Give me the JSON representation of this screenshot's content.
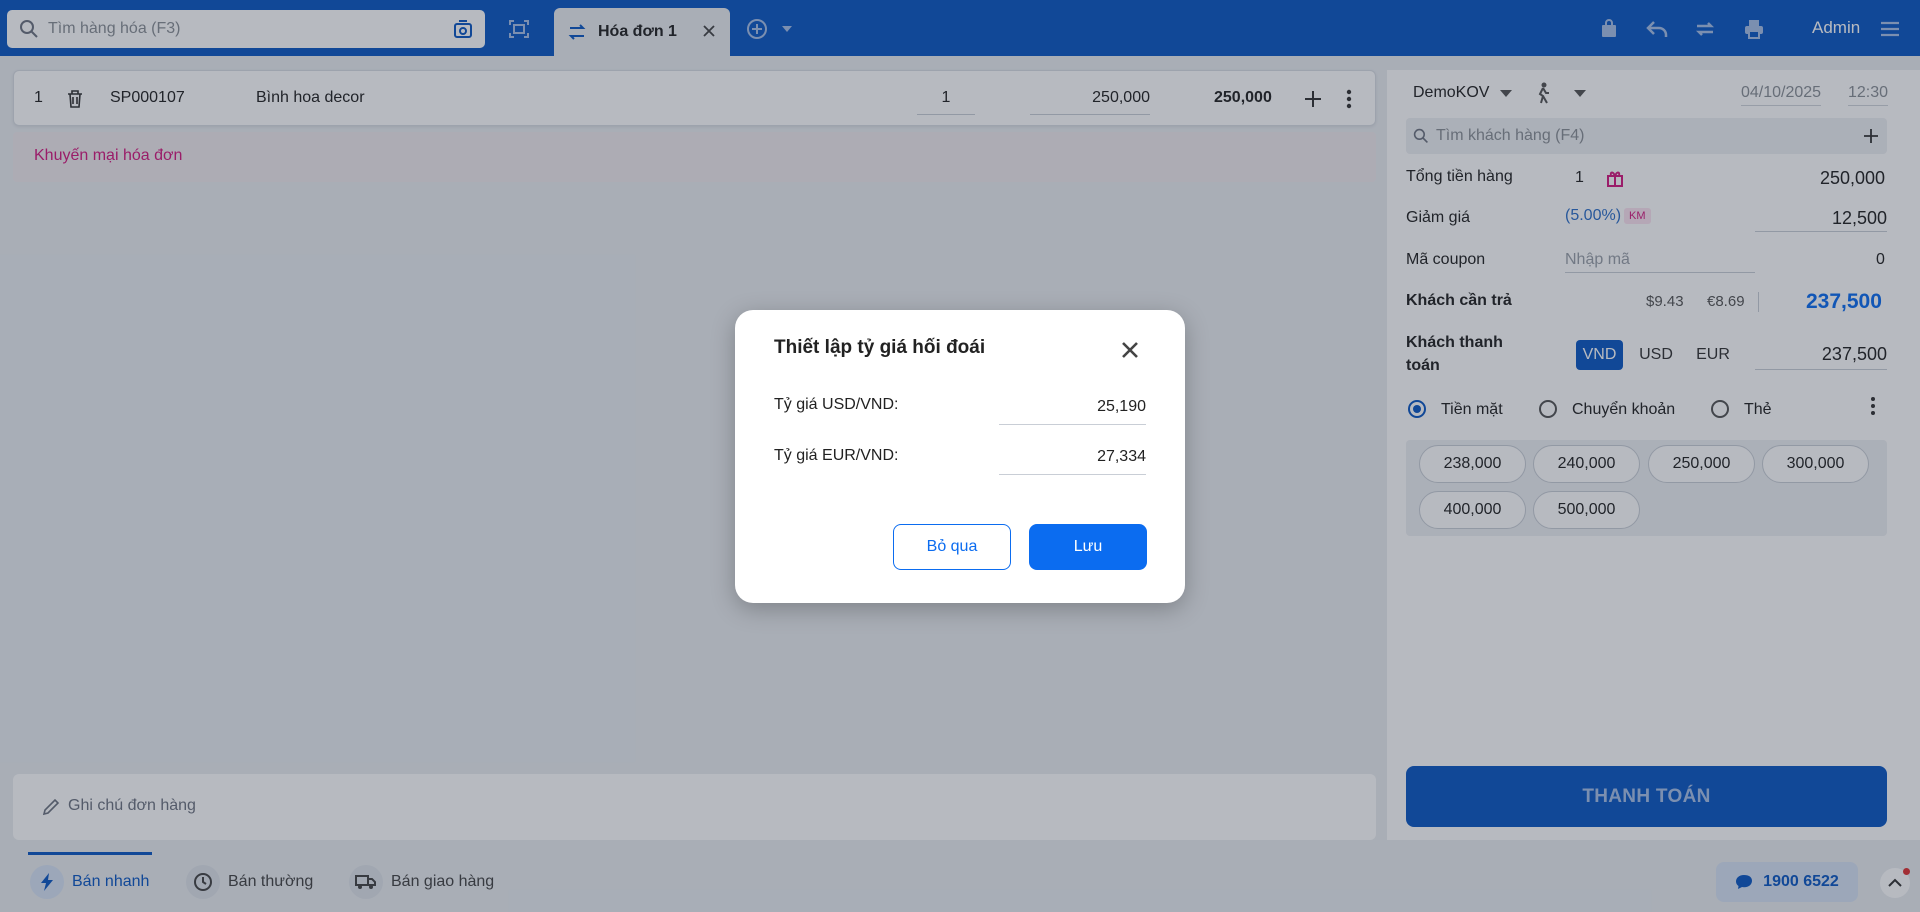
{
  "topbar": {
    "search_placeholder": "Tìm hàng hóa (F3)",
    "tab_label": "Hóa đơn 1",
    "user": "Admin"
  },
  "cart": {
    "items": [
      {
        "index": "1",
        "code": "SP000107",
        "name": "Bình hoa decor",
        "quantity": "1",
        "price": "250,000",
        "total": "250,000"
      }
    ],
    "promotion_label": "Khuyến mại hóa đơn",
    "note_placeholder": "Ghi chú đơn hàng"
  },
  "checkout": {
    "branch": "DemoKOV",
    "date": "04/10/2025",
    "time": "12:30",
    "customer_search_placeholder": "Tìm khách hàng (F4)",
    "subtotal_label": "Tổng tiền hàng",
    "subtotal_count": "1",
    "subtotal_value": "250,000",
    "discount_label": "Giảm giá",
    "discount_percent": "(5.00%)",
    "discount_badge": "KM",
    "discount_value": "12,500",
    "coupon_label": "Mã coupon",
    "coupon_placeholder": "Nhập mã",
    "coupon_value": "0",
    "due_label": "Khách cần trả",
    "due_usd": "$9.43",
    "due_eur": "€8.69",
    "due_value": "237,500",
    "paid_label_1": "Khách thanh",
    "paid_label_2": "toán",
    "currencies": [
      "VND",
      "USD",
      "EUR"
    ],
    "paid_value": "237,500",
    "methods": [
      "Tiền mặt",
      "Chuyển khoản",
      "Thẻ"
    ],
    "quick_amounts": [
      "238,000",
      "240,000",
      "250,000",
      "300,000",
      "400,000",
      "500,000"
    ],
    "pay_button": "THANH TOÁN"
  },
  "bottombar": {
    "modes": [
      "Bán nhanh",
      "Bán thường",
      "Bán giao hàng"
    ],
    "hotline": "1900 6522"
  },
  "modal": {
    "title": "Thiết lập tỷ giá hối đoái",
    "usd_label": "Tỷ giá USD/VND:",
    "usd_value": "25,190",
    "eur_label": "Tỷ giá EUR/VND:",
    "eur_value": "27,334",
    "cancel_label": "Bỏ qua",
    "save_label": "Lưu"
  },
  "colors": {
    "brand": "#0b57c3",
    "accent_button": "#0b6cf0",
    "promo": "#d4187f"
  }
}
